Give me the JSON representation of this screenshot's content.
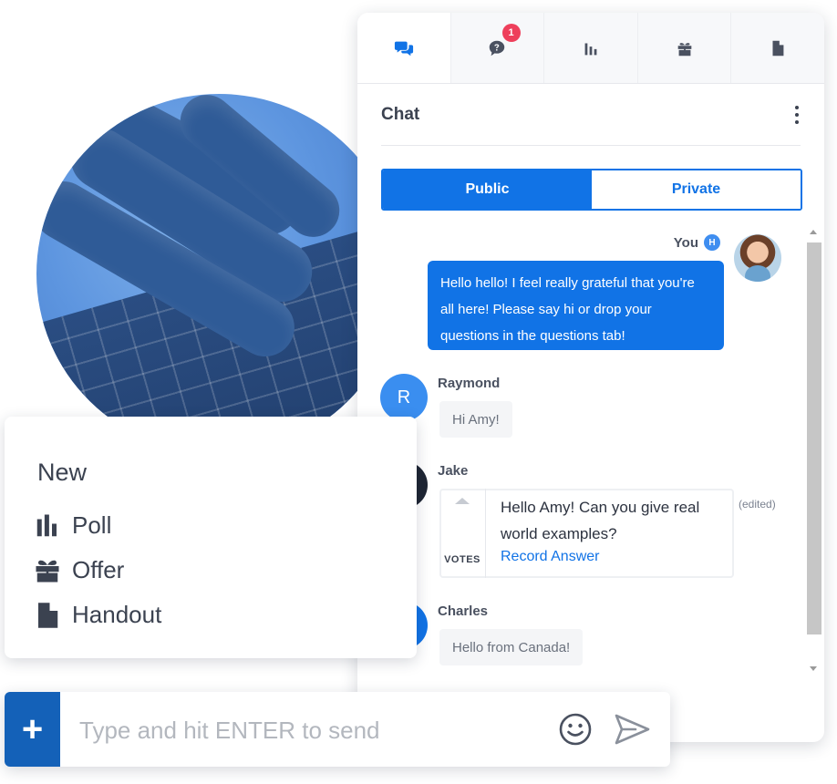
{
  "tabs": [
    {
      "icon": "chat-bubbles-icon",
      "active": true
    },
    {
      "icon": "questions-icon",
      "badge": "1"
    },
    {
      "icon": "poll-icon"
    },
    {
      "icon": "gift-icon"
    },
    {
      "icon": "handout-icon"
    }
  ],
  "chat": {
    "title": "Chat",
    "segments": {
      "public": "Public",
      "private": "Private",
      "selected": "Public"
    },
    "own_message": {
      "sender": "You",
      "host_badge": "H",
      "text": "Hello hello! I feel really grateful that you're all here! Please say hi or drop your questions in the questions tab!"
    },
    "messages": [
      {
        "sender": "Raymond",
        "avatar_letter": "R",
        "avatar_color": "#3a8ef0",
        "text": "Hi Amy!"
      },
      {
        "sender": "Jake",
        "avatar_color": "#1e2533",
        "question": "Hello Amy! Can you give real world examples?",
        "votes_label": "VOTES",
        "action": "Record Answer",
        "edited": "(edited)"
      },
      {
        "sender": "Charles",
        "avatar_color": "#1173e6",
        "text": "Hello from Canada!"
      }
    ]
  },
  "new_menu": {
    "title": "New",
    "items": [
      {
        "icon": "poll-icon",
        "label": "Poll"
      },
      {
        "icon": "gift-icon",
        "label": "Offer"
      },
      {
        "icon": "handout-icon",
        "label": "Handout"
      }
    ]
  },
  "composer": {
    "add_label": "+",
    "placeholder": "Type and hit ENTER to send"
  },
  "colors": {
    "primary": "#1173e6",
    "badge": "#ee3f5b",
    "text": "#3b4250"
  }
}
